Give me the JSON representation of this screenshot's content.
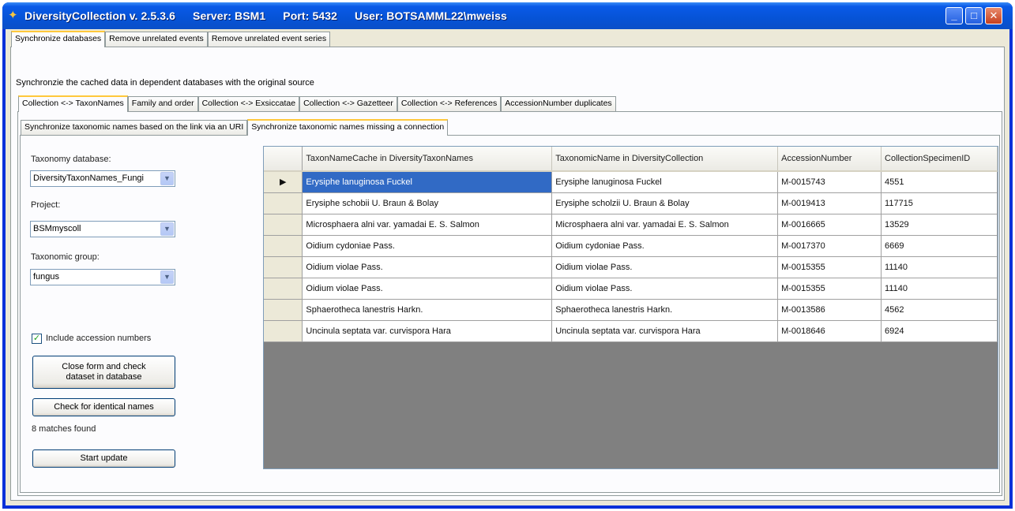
{
  "window": {
    "title_parts": [
      "DiversityCollection  v. 2.5.3.6",
      "Server: BSM1",
      "Port: 5432",
      "User: BOTSAMML22\\mweiss"
    ],
    "controls": {
      "minimize": "_",
      "maximize": "□",
      "close": "✕"
    }
  },
  "top_tabs": [
    "Synchronize databases",
    "Remove unrelated events",
    "Remove unrelated event series"
  ],
  "description": "Synchronzie the cached data in dependent databases with the original source",
  "sync_tabs": [
    "Collection <-> TaxonNames",
    "Family and order",
    "Collection <-> Exsiccatae",
    "Collection <-> Gazetteer",
    "Collection <-> References",
    "AccessionNumber duplicates"
  ],
  "sub_tabs": [
    "Synchronize taxonomic names based on the link via an URI",
    "Synchronize taxonomic names missing a connection"
  ],
  "form": {
    "taxonomy_label": "Taxonomy database:",
    "taxonomy_value": "DiversityTaxonNames_Fungi",
    "project_label": "Project:",
    "project_value": "BSMmyscoll",
    "group_label": "Taxonomic group:",
    "group_value": "fungus",
    "include_accession_label": "Include accession numbers",
    "include_accession_checked": "✓",
    "close_form_button": "Close form and check dataset in database",
    "check_identical_button": "Check for identical names",
    "matches_text": "8 matches found",
    "start_update_button": "Start update"
  },
  "grid": {
    "current_row_marker": "▶",
    "columns": [
      "TaxonNameCache in DiversityTaxonNames",
      "TaxonomicName in DiversityCollection",
      "AccessionNumber",
      "CollectionSpecimenID"
    ],
    "rows": [
      [
        "Erysiphe lanuginosa Fuckel",
        "Erysiphe lanuginosa Fuckel",
        "M-0015743",
        "4551"
      ],
      [
        "Erysiphe schobii U. Braun & Bolay",
        "Erysiphe scholzii U. Braun & Bolay",
        "M-0019413",
        "117715"
      ],
      [
        "Microsphaera alni var. yamadai E. S. Salmon",
        "Microsphaera alni var. yamadai E. S. Salmon",
        "M-0016665",
        "13529"
      ],
      [
        "Oidium cydoniae Pass.",
        "Oidium cydoniae Pass.",
        "M-0017370",
        "6669"
      ],
      [
        "Oidium violae Pass.",
        "Oidium violae Pass.",
        "M-0015355",
        "11140"
      ],
      [
        "Oidium violae Pass.",
        "Oidium violae Pass.",
        "M-0015355",
        "11140"
      ],
      [
        "Sphaerotheca lanestris Harkn.",
        "Sphaerotheca lanestris Harkn.",
        "M-0013586",
        "4562"
      ],
      [
        "Uncinula septata var. curvispora Hara",
        "Uncinula septata var. curvispora Hara",
        "M-0018646",
        "6924"
      ]
    ]
  },
  "colors": {
    "title_bar": "#0653d6",
    "selection": "#316ac5",
    "tab_highlight": "#ffc83c",
    "grid_background": "#808080"
  }
}
